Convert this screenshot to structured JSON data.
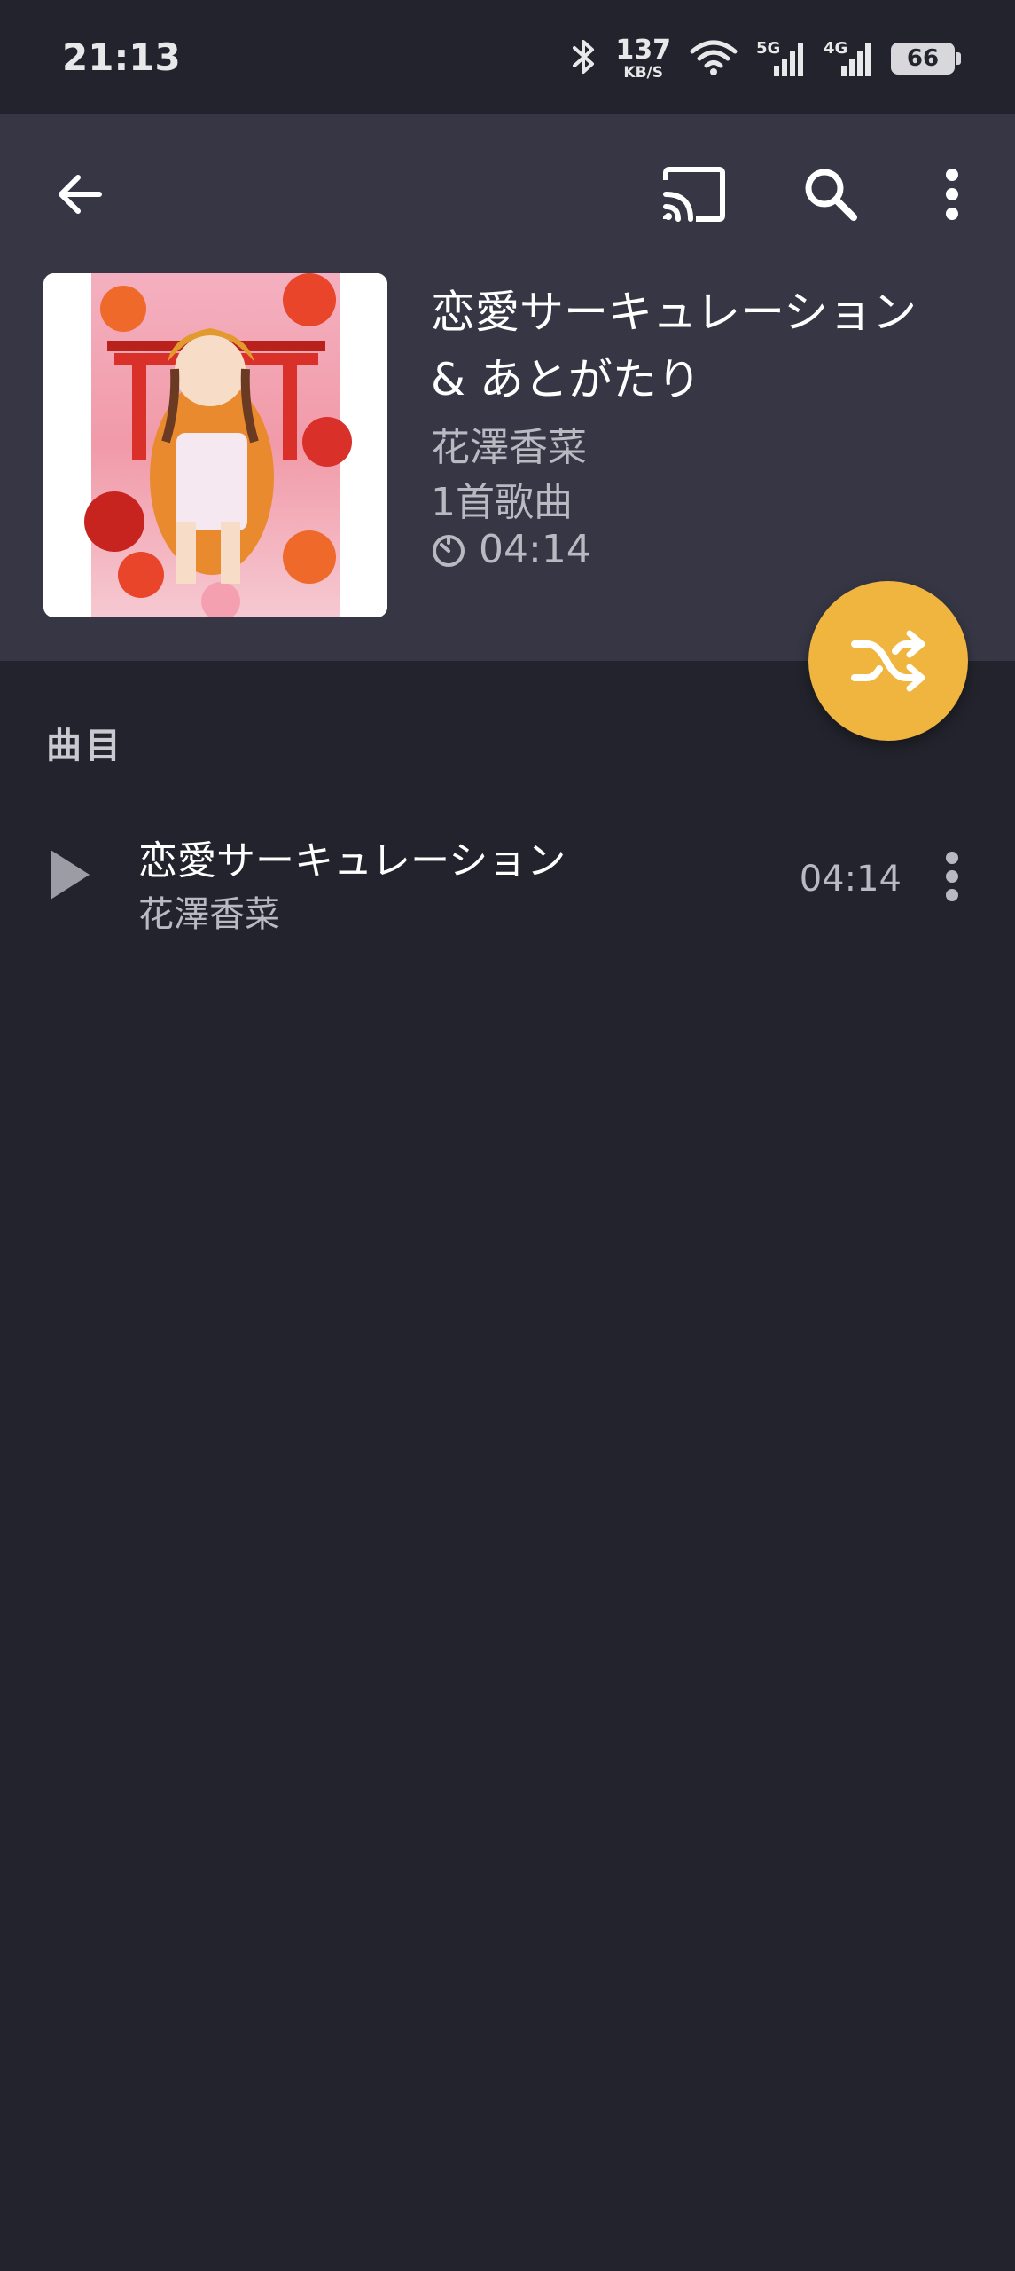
{
  "status_bar": {
    "time": "21:13",
    "net_speed_value": "137",
    "net_speed_unit": "KB/S",
    "sim1_label": "5G",
    "sim2_label": "4G",
    "battery": "66"
  },
  "toolbar": {
    "back_icon": "arrow-back-icon",
    "cast_icon": "cast-icon",
    "search_icon": "search-icon",
    "more_icon": "more-vert-icon"
  },
  "album": {
    "title": "恋愛サーキュレーション & あとがたり",
    "artist": "花澤香菜",
    "song_count": "1首歌曲",
    "duration": "04:14",
    "cover_icon": "album-cover-art"
  },
  "shuffle_button": {
    "icon": "shuffle-icon",
    "color": "#f0b53e"
  },
  "tracks_section": {
    "label": "曲目"
  },
  "tracks": [
    {
      "title": "恋愛サーキュレーション",
      "artist": "花澤香菜",
      "duration": "04:14"
    }
  ],
  "colors": {
    "background": "#23232d",
    "header": "#363645",
    "accent": "#f0b53e"
  }
}
